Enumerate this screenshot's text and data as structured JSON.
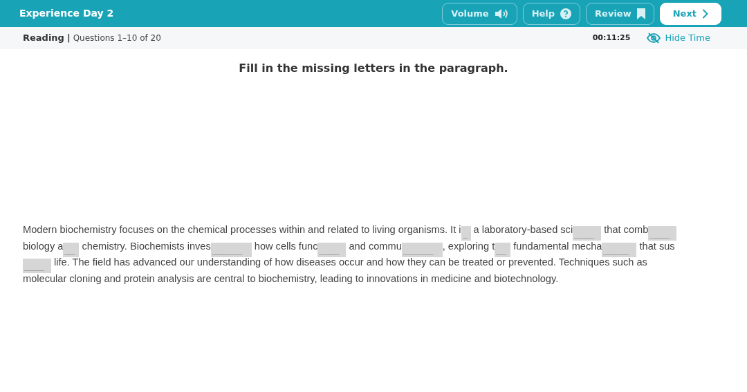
{
  "header": {
    "title": "Experience Day 2",
    "buttons": [
      {
        "kind": "volume",
        "label": "Volume",
        "primary": false
      },
      {
        "kind": "help",
        "label": "Help",
        "primary": false
      },
      {
        "kind": "review",
        "label": "Review",
        "primary": false
      },
      {
        "kind": "next",
        "label": "Next",
        "primary": true
      }
    ]
  },
  "subheader": {
    "section": "Reading",
    "separator": "|",
    "questions": "Questions 1–10 of 20",
    "timer": "00:11:25",
    "hide_time": "Hide Time"
  },
  "instruction": "Fill in the missing letters in the paragraph.",
  "passage_lines": [
    [
      {
        "kind": "text",
        "text": "Modern biochemistry focuses on the chemical processes within and related to living organisms. It i"
      },
      {
        "kind": "blank",
        "placeholder": "_"
      },
      {
        "kind": "text",
        "text": " a laboratory-based sci"
      },
      {
        "kind": "blank",
        "placeholder": "____"
      },
      {
        "kind": "text",
        "text": " that comb"
      },
      {
        "kind": "blank",
        "placeholder": "____"
      }
    ],
    [
      {
        "kind": "text",
        "text": "biology a"
      },
      {
        "kind": "blank",
        "placeholder": "__"
      },
      {
        "kind": "text",
        "text": " chemistry. Biochemists inves"
      },
      {
        "kind": "blank",
        "placeholder": "______"
      },
      {
        "kind": "text",
        "text": " how cells func"
      },
      {
        "kind": "blank",
        "placeholder": "____"
      },
      {
        "kind": "text",
        "text": " and commu"
      },
      {
        "kind": "blank",
        "placeholder": "______"
      },
      {
        "kind": "text",
        "text": ", exploring t"
      },
      {
        "kind": "blank",
        "placeholder": "__"
      },
      {
        "kind": "text",
        "text": " fundamental mecha"
      },
      {
        "kind": "blank",
        "placeholder": "_____"
      },
      {
        "kind": "text",
        "text": " that sus"
      }
    ],
    [
      {
        "kind": "blank",
        "placeholder": "____"
      },
      {
        "kind": "text",
        "text": " life. The field has advanced our understanding of how diseases occur and how they can be treated or prevented. Techniques such as"
      }
    ],
    [
      {
        "kind": "text",
        "text": "molecular cloning and protein analysis are central to biochemistry, leading to innovations in medicine and biotechnology."
      }
    ]
  ]
}
